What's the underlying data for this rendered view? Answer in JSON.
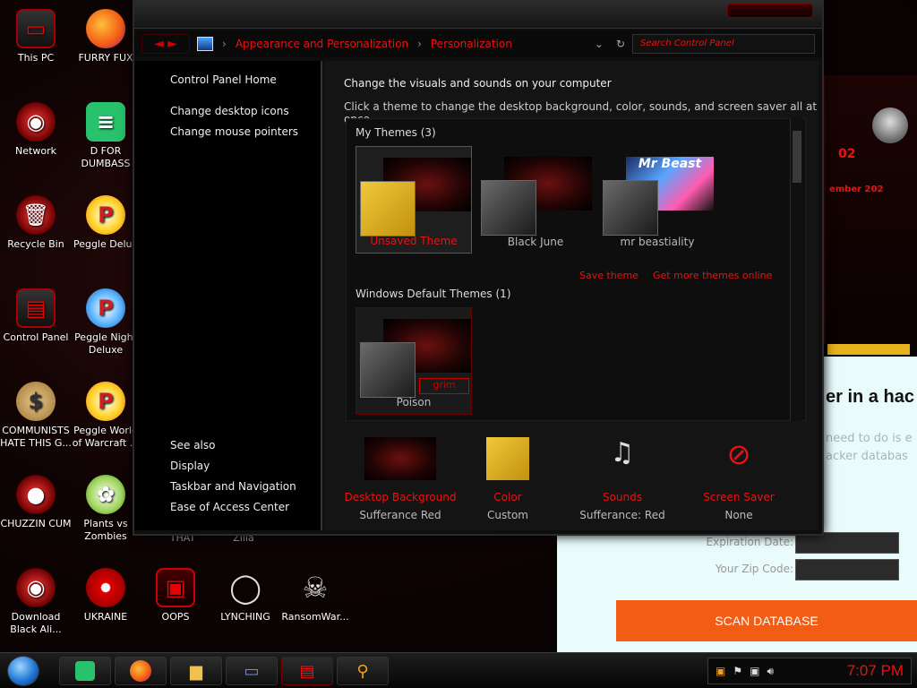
{
  "desktop_icons": [
    {
      "label": "This PC"
    },
    {
      "label": "FURRY FUX"
    },
    {
      "label": "Network"
    },
    {
      "label": "D FOR DUMBASS"
    },
    {
      "label": "Recycle Bin"
    },
    {
      "label": "Peggle Delux"
    },
    {
      "label": "Control Panel"
    },
    {
      "label": "Peggle Night Deluxe"
    },
    {
      "label": "COMMUNISTS HATE THIS G..."
    },
    {
      "label": "Peggle World of Warcraft ..."
    },
    {
      "label": "CHUZZIN CUM"
    },
    {
      "label": "Plants vs Zombies"
    },
    {
      "label": "Download Black Ali..."
    },
    {
      "label": "UKRAINE"
    },
    {
      "label": "OOPS"
    },
    {
      "label": "LYNCHING"
    },
    {
      "label": "RansomWar..."
    },
    {
      "label": "THAT"
    },
    {
      "label": "Zilla"
    }
  ],
  "window": {
    "breadcrumb": [
      "Appearance and Personalization",
      "Personalization"
    ],
    "search_placeholder": "Search Control Panel",
    "sidebar": {
      "home": "Control Panel Home",
      "links": [
        "Change desktop icons",
        "Change mouse pointers"
      ],
      "see_also": "See also",
      "see_also_links": [
        "Display",
        "Taskbar and Navigation",
        "Ease of Access Center"
      ]
    },
    "heading": "Change the visuals and sounds on your computer",
    "subheading": "Click a theme to change the desktop background, color, sounds, and screen saver all at once.",
    "my_themes_label": "My Themes (3)",
    "my_themes": [
      {
        "name": "Unsaved Theme",
        "swatch": "#e7b21c"
      },
      {
        "name": "Black June",
        "swatch": "#3a3a3a"
      },
      {
        "name": "mr beastiality",
        "swatch": "#3a3a3a",
        "wall_text": "Mr Beast"
      }
    ],
    "save_theme": "Save theme",
    "get_more": "Get more themes online",
    "default_themes_label": "Windows Default Themes (1)",
    "default_themes": [
      {
        "name": "Poison",
        "swatch": "#3a3a3a",
        "badge": "grim"
      }
    ],
    "bottom": [
      {
        "title": "Desktop Background",
        "value": "Sufferance Red"
      },
      {
        "title": "Color",
        "value": "Custom"
      },
      {
        "title": "Sounds",
        "value": "Sufferance: Red"
      },
      {
        "title": "Screen Saver",
        "value": "None"
      }
    ]
  },
  "background_page": {
    "headline": "er in a hac",
    "line1": "need to do is e",
    "line2": "acker databas",
    "expiration_label": "Expiration Date:",
    "zip_label": "Your Zip Code:",
    "scan_button": "SCAN DATABASE"
  },
  "background_app": {
    "text1": "02",
    "text2": "ember 202"
  },
  "taskbar": {
    "clock": "7:07 PM"
  },
  "colors": {
    "accent": "#e11111",
    "scan_button": "#f25c14"
  }
}
